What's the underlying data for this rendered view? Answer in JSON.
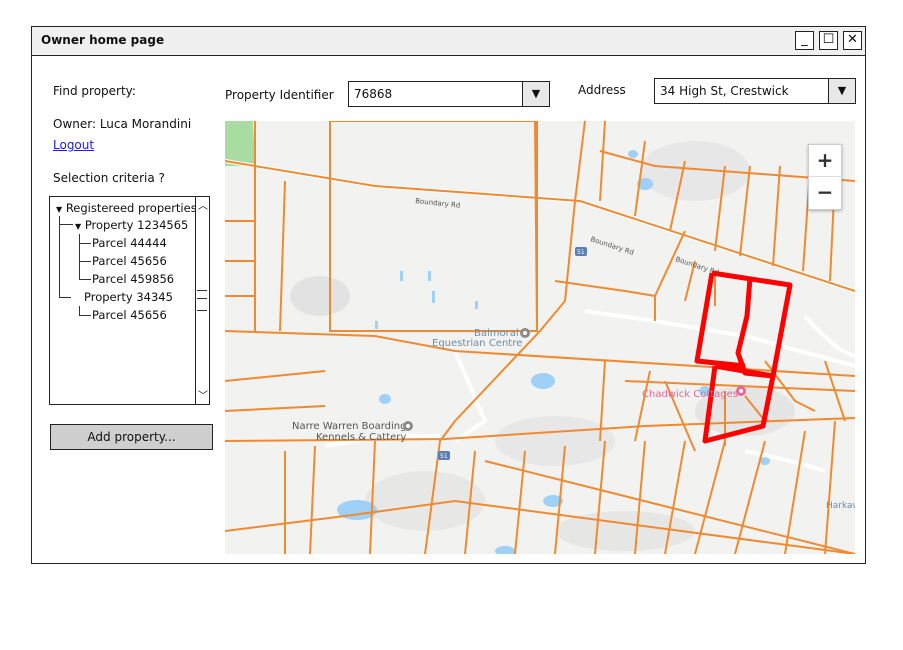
{
  "window": {
    "title": "Owner home page",
    "minimize_symbol": "_",
    "maximize_symbol": "☐",
    "close_symbol": "✕"
  },
  "sidebar": {
    "find_property_label": "Find property:",
    "owner_text": "Owner: Luca Morandini",
    "logout_label": "Logout",
    "selection_criteria_label": "Selection criteria ?",
    "tree": {
      "root": "Registereed properties",
      "properties": [
        {
          "label": "Property 1234565",
          "parcels": [
            "Parcel 44444",
            "Parcel 45656",
            "Parcel 459856"
          ]
        },
        {
          "label": "Property 34345",
          "parcels": [
            "Parcel 45656"
          ]
        }
      ]
    },
    "add_property_label": "Add property..."
  },
  "search": {
    "property_identifier_label": "Property Identifier",
    "property_identifier_value": "76868",
    "address_label": "Address",
    "address_value": "34 High St, Crestwick"
  },
  "map": {
    "zoom_in": "+",
    "zoom_out": "−",
    "labels": {
      "boundary_rd": "Boundary Rd",
      "balmoral": "Balmoral",
      "equestrian_centre": "Equestrian Centre",
      "chadwick_cottages": "Chadwick Cottages",
      "narre_warren": "Narre Warren Boarding",
      "kennels": "Kennels & Cattery",
      "harkaway": "Harkaw",
      "route_shield": "51"
    },
    "colors": {
      "parcel_lines": "#f08a30",
      "highlight": "#ff0000",
      "water": "#9fd0f5",
      "park": "#a8dca0",
      "poi_text": "#5a8fb0",
      "poi_pink": "#e8679a"
    }
  }
}
